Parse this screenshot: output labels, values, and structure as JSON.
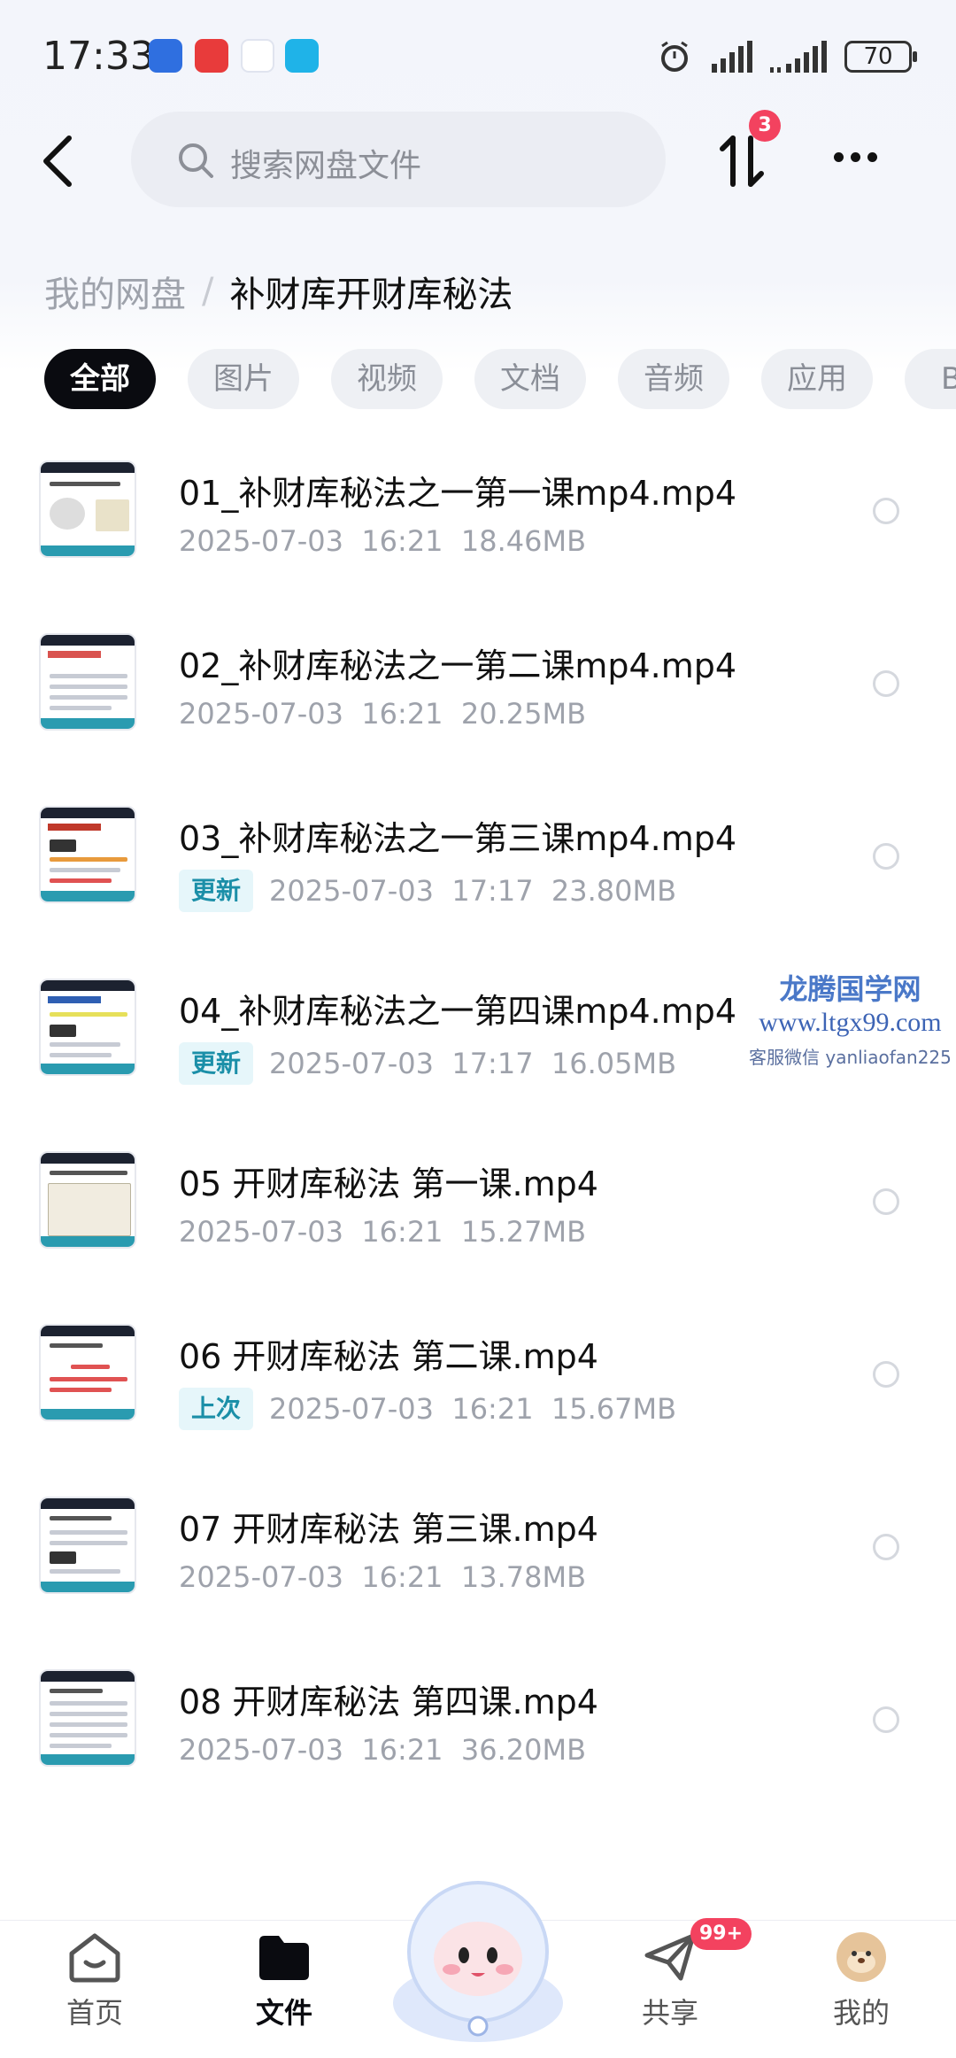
{
  "status_bar": {
    "time": "17:33",
    "battery": "70"
  },
  "header": {
    "search_placeholder": "搜索网盘文件",
    "transfer_badge": "3"
  },
  "breadcrumb": {
    "root": "我的网盘",
    "sep": "/",
    "current": "补财库开财库秘法"
  },
  "tabs": [
    {
      "label": "全部",
      "active": true
    },
    {
      "label": "图片"
    },
    {
      "label": "视频"
    },
    {
      "label": "文档"
    },
    {
      "label": "音频"
    },
    {
      "label": "应用"
    },
    {
      "label": "BT"
    }
  ],
  "files": [
    {
      "name": "01_补财库秘法之一第一课mp4.mp4",
      "tag": "",
      "date": "2025-07-03",
      "time": "16:21",
      "size": "18.46MB"
    },
    {
      "name": "02_补财库秘法之一第二课mp4.mp4",
      "tag": "",
      "date": "2025-07-03",
      "time": "16:21",
      "size": "20.25MB"
    },
    {
      "name": "03_补财库秘法之一第三课mp4.mp4",
      "tag": "更新",
      "date": "2025-07-03",
      "time": "17:17",
      "size": "23.80MB"
    },
    {
      "name": "04_补财库秘法之一第四课mp4.mp4",
      "tag": "更新",
      "date": "2025-07-03",
      "time": "17:17",
      "size": "16.05MB"
    },
    {
      "name": "05 开财库秘法 第一课.mp4",
      "tag": "",
      "date": "2025-07-03",
      "time": "16:21",
      "size": "15.27MB"
    },
    {
      "name": "06 开财库秘法 第二课.mp4",
      "tag": "上次",
      "date": "2025-07-03",
      "time": "16:21",
      "size": "15.67MB"
    },
    {
      "name": "07 开财库秘法 第三课.mp4",
      "tag": "",
      "date": "2025-07-03",
      "time": "16:21",
      "size": "13.78MB"
    },
    {
      "name": "08 开财库秘法 第四课.mp4",
      "tag": "",
      "date": "2025-07-03",
      "time": "16:21",
      "size": "36.20MB"
    }
  ],
  "watermark": {
    "line1": "龙腾国学网",
    "line2": "www.ltgx99.com",
    "line3": "客服微信 yanliaofan225"
  },
  "bottom_nav": {
    "home": "首页",
    "files": "文件",
    "share": "共享",
    "share_badge": "99+",
    "mine": "我的"
  },
  "icons": [
    "back-icon",
    "search-icon",
    "transfer-icon",
    "more-icon",
    "home-icon",
    "folder-icon",
    "share-icon",
    "avatar-icon"
  ],
  "colors": {
    "accent": "#0a0b10",
    "tag_text": "#1b8fa8",
    "badge": "#f3425f"
  }
}
